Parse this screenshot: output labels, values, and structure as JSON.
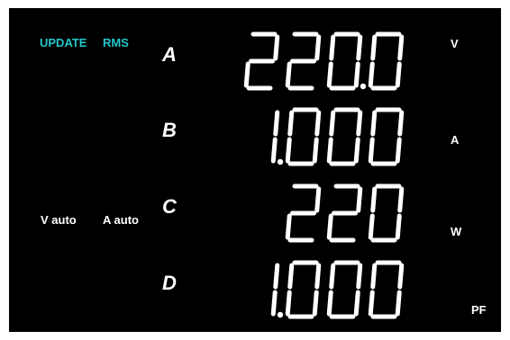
{
  "colors": {
    "screen_bg": "#000000",
    "status_text": "#22c6cc",
    "text": "#ffffff"
  },
  "status": {
    "update": "UPDATE",
    "mode": "RMS"
  },
  "ranges": {
    "voltage": "V auto",
    "current": "A auto"
  },
  "rows": [
    {
      "channel": "A",
      "value": "220.0",
      "unit": "V"
    },
    {
      "channel": "B",
      "value": "1.000",
      "unit": "A"
    },
    {
      "channel": "C",
      "value": "220",
      "unit": "W"
    },
    {
      "channel": "D",
      "value": "1.000",
      "unit": "PF"
    }
  ]
}
